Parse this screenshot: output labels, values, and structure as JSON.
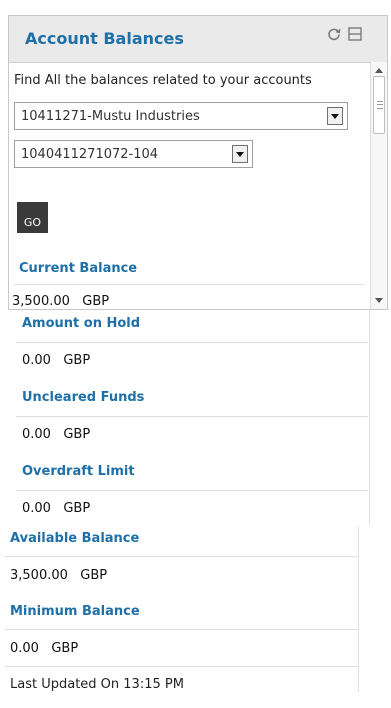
{
  "widget": {
    "title": "Account Balances",
    "icons": {
      "refresh": "refresh-icon",
      "collapse": "collapse-icon"
    },
    "description": "Find All the balances related to your accounts",
    "party_select": {
      "value": "10411271-Mustu Industries"
    },
    "account_select": {
      "value": "1040411271072-104"
    },
    "go_label": "GO",
    "current_balance": {
      "label": "Current Balance",
      "amount": "3,500.00",
      "currency": "GBP"
    }
  },
  "balances": [
    {
      "label": "Amount on Hold",
      "amount": "0.00",
      "currency": "GBP"
    },
    {
      "label": "Uncleared Funds",
      "amount": "0.00",
      "currency": "GBP"
    },
    {
      "label": "Overdraft Limit",
      "amount": "0.00",
      "currency": "GBP"
    },
    {
      "label": "Available Balance",
      "amount": "3,500.00",
      "currency": "GBP"
    },
    {
      "label": "Minimum Balance",
      "amount": "0.00",
      "currency": "GBP"
    }
  ],
  "last_updated": "Last Updated On 13:15 PM",
  "colors": {
    "accent": "#1f6fa8",
    "header_bg": "#eaeaea",
    "button_bg": "#3a3a3a"
  }
}
